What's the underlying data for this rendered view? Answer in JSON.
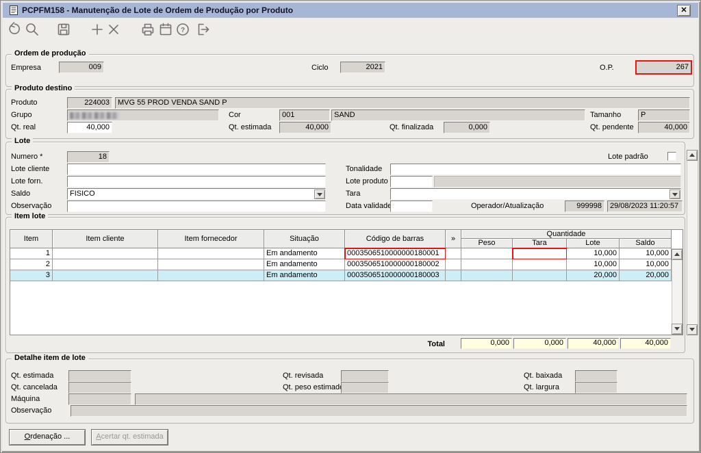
{
  "window": {
    "title": "PCPFM158 - Manutenção de Lote de Ordem de Produção por Produto",
    "close_glyph": "✕"
  },
  "toolbar": {
    "icons": [
      "refresh",
      "search",
      "save",
      "add",
      "delete",
      "print",
      "calendar",
      "help",
      "exit"
    ]
  },
  "ordem_producao": {
    "legend": "Ordem de produção",
    "empresa_label": "Empresa",
    "empresa": "009",
    "ciclo_label": "Ciclo",
    "ciclo": "2021",
    "op_label": "O.P.",
    "op": "267"
  },
  "produto_destino": {
    "legend": "Produto destino",
    "produto_label": "Produto",
    "produto_codigo": "224003",
    "produto_desc": "MVG 55 PROD VENDA SAND P",
    "grupo_label": "Grupo",
    "cor_label": "Cor",
    "cor_codigo": "001",
    "cor_desc": "SAND",
    "tamanho_label": "Tamanho",
    "tamanho": "P",
    "qt_real_label": "Qt. real",
    "qt_real": "40,000",
    "qt_estimada_label": "Qt. estimada",
    "qt_estimada": "40,000",
    "qt_finalizada_label": "Qt. finalizada",
    "qt_finalizada": "0,000",
    "qt_pendente_label": "Qt. pendente",
    "qt_pendente": "40,000"
  },
  "lote": {
    "legend": "Lote",
    "numero_label": "Numero *",
    "numero": "18",
    "lote_padrao_label": "Lote padrão",
    "lote_cliente_label": "Lote cliente",
    "lote_cliente": "",
    "tonalidade_label": "Tonalidade",
    "tonalidade": "",
    "lote_forn_label": "Lote forn.",
    "lote_forn": "",
    "lote_produto_label": "Lote produto",
    "lote_produto": "",
    "saldo_label": "Saldo",
    "saldo": "FISICO",
    "tara_label": "Tara",
    "tara": "",
    "observacao_label": "Observação",
    "observacao": "",
    "data_validade_label": "Data validade",
    "data_validade": "",
    "operador_label": "Operador/Atualização",
    "operador": "999998",
    "atualizacao": "29/08/2023 11:20:57"
  },
  "item_lote": {
    "legend": "Item lote",
    "columns": {
      "item": "Item",
      "item_cliente": "Item cliente",
      "item_fornecedor": "Item fornecedor",
      "situacao": "Situação",
      "codigo_barras": "Código de barras",
      "expand": "»",
      "quantidade": "Quantidade",
      "peso": "Peso",
      "tara": "Tara",
      "lote": "Lote",
      "saldo": "Saldo"
    },
    "rows": [
      {
        "item": "1",
        "item_cliente": "",
        "item_fornecedor": "",
        "situacao": "Em andamento",
        "codigo_barras": "0003506510000000180001",
        "peso": "",
        "tara": "",
        "lote": "10,000",
        "saldo": "10,000",
        "selected": false,
        "highlight": [
          "codigo_barras",
          "tara"
        ]
      },
      {
        "item": "2",
        "item_cliente": "",
        "item_fornecedor": "",
        "situacao": "Em andamento",
        "codigo_barras": "0003506510000000180002",
        "peso": "",
        "tara": "",
        "lote": "10,000",
        "saldo": "10,000",
        "selected": false,
        "highlight": []
      },
      {
        "item": "3",
        "item_cliente": "",
        "item_fornecedor": "",
        "situacao": "Em andamento",
        "codigo_barras": "0003506510000000180003",
        "peso": "",
        "tara": "",
        "lote": "20,000",
        "saldo": "20,000",
        "selected": true,
        "highlight": []
      }
    ],
    "total_label": "Total",
    "total": {
      "peso": "0,000",
      "tara": "0,000",
      "lote": "40,000",
      "saldo": "40,000"
    }
  },
  "detalhe": {
    "legend": "Detalhe item de lote",
    "qt_estimada_label": "Qt. estimada",
    "qt_revisada_label": "Qt. revisada",
    "qt_baixada_label": "Qt. baixada",
    "qt_cancelada_label": "Qt. cancelada",
    "qt_peso_estimado_label": "Qt. peso estimado",
    "qt_largura_label": "Qt. largura",
    "maquina_label": "Máquina",
    "observacao_label": "Observação"
  },
  "footer": {
    "ordenacao_button": "Ordenação ...",
    "acertar_button": "Acertar qt. estimada"
  },
  "colors": {
    "titlebar": "#a8b6d5",
    "highlight_red": "#ee0f0f",
    "selected_row": "#cdeef7",
    "total_bg": "#ffffdf",
    "disabled_field": "#d8d5d0"
  }
}
